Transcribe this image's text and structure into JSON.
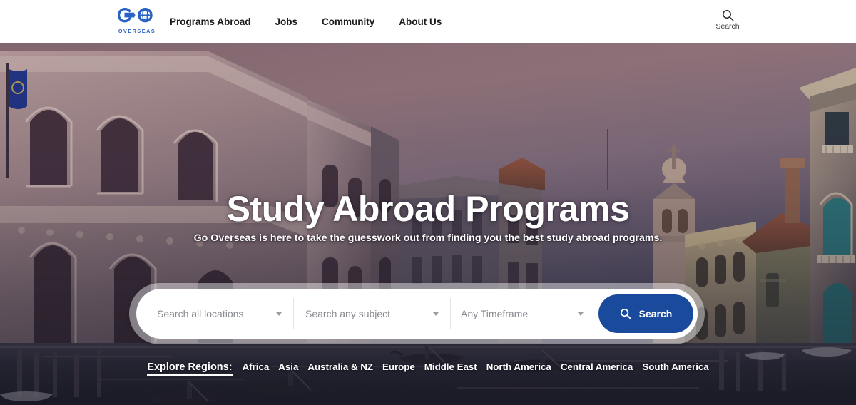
{
  "header": {
    "logo": {
      "mark_text": "GO",
      "sub_text": "OVERSEAS",
      "icon": "globe-icon",
      "color": "#2a62c4"
    },
    "nav": [
      {
        "label": "Programs Abroad"
      },
      {
        "label": "Jobs"
      },
      {
        "label": "Community"
      },
      {
        "label": "About Us"
      }
    ],
    "search": {
      "icon": "search-icon",
      "label": "Search"
    }
  },
  "hero": {
    "title": "Study Abroad Programs",
    "subtitle": "Go Overseas is here to take the guesswork out from finding you the best study abroad programs.",
    "background_description": "Venice Grand Canal at dusk with palazzos and gondolas"
  },
  "search_form": {
    "location": {
      "value": "Search all locations",
      "placeholder": "Search all locations",
      "caret": "chevron-down-icon"
    },
    "subject": {
      "value": "Search any subject",
      "placeholder": "Search any subject",
      "caret": "chevron-down-icon"
    },
    "timeframe": {
      "value": "Any Timeframe",
      "placeholder": "Any Timeframe",
      "caret": "chevron-down-icon"
    },
    "submit": {
      "label": "Search",
      "icon": "search-icon",
      "color": "#1a4a9c"
    }
  },
  "regions": {
    "label": "Explore Regions:",
    "items": [
      {
        "label": "Africa"
      },
      {
        "label": "Asia"
      },
      {
        "label": "Australia & NZ"
      },
      {
        "label": "Europe"
      },
      {
        "label": "Middle East"
      },
      {
        "label": "North America"
      },
      {
        "label": "Central America"
      },
      {
        "label": "South America"
      }
    ]
  }
}
